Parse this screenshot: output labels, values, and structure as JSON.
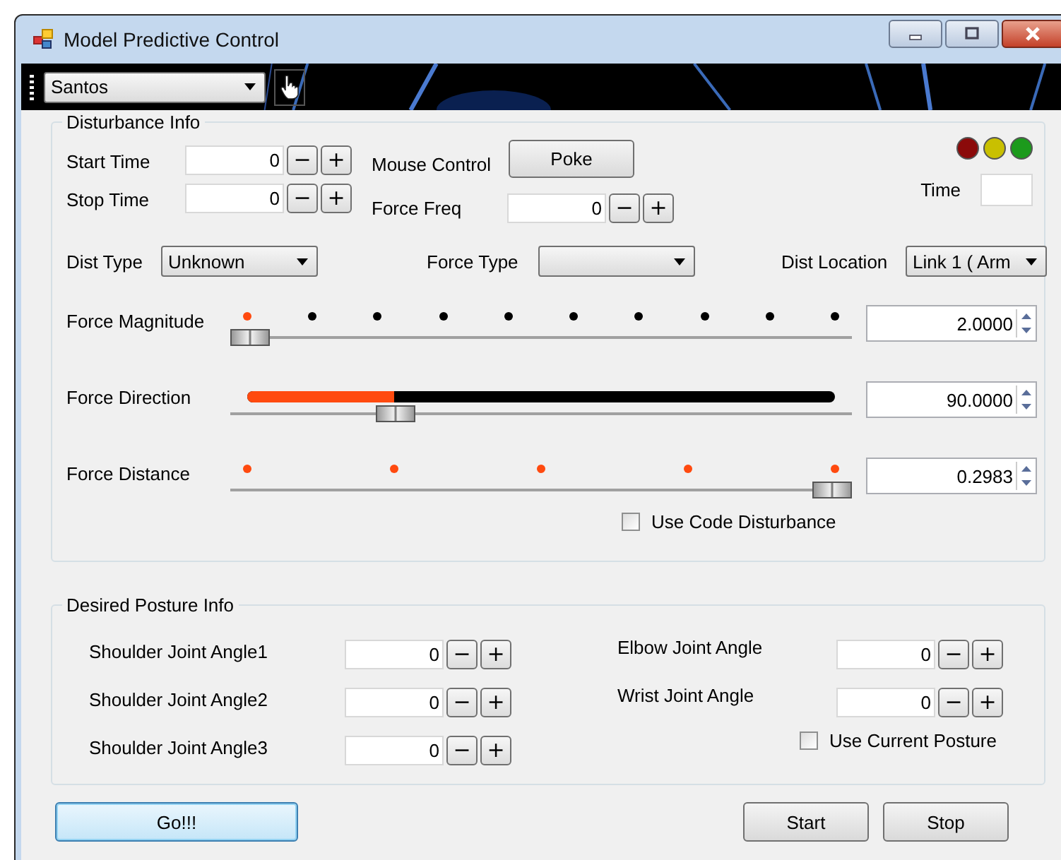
{
  "window": {
    "title": "Model Predictive Control"
  },
  "toolbar": {
    "profile": "Santos"
  },
  "disturbance": {
    "title": "Disturbance Info",
    "spinners": [
      {
        "label": "Start Time",
        "value": "0",
        "dec": "−",
        "inc": "+"
      },
      {
        "label": "Stop Time",
        "value": "0",
        "dec": "−",
        "inc": "+"
      },
      {
        "label": "Force Freq",
        "value": "0",
        "dec": "−",
        "inc": "+"
      }
    ],
    "mouse_control": {
      "label": "Mouse Control",
      "button": "Poke"
    },
    "status_lights": [
      {
        "color": "#8b0a0a"
      },
      {
        "color": "#c9c000"
      },
      {
        "color": "#1c9a1c"
      }
    ],
    "time": {
      "label": "Time"
    },
    "dropdowns": [
      {
        "label": "Dist Type",
        "value": "Unknown"
      },
      {
        "label": "Force Type"
      },
      {
        "label": "Dist Location",
        "value": "Link 1 ( Arm"
      }
    ],
    "sliders": [
      {
        "kind": "fine_ticks",
        "label": "Force Magnitude",
        "value": "2.0000",
        "level": 0.0
      },
      {
        "kind": "bar",
        "label": "Force Direction",
        "value": "90.0000",
        "level": 0.25
      },
      {
        "kind": "coarse_ticks",
        "label": "Force Distance",
        "value": "0.2983",
        "level": 1.0
      }
    ],
    "use_code_disturbance": {
      "label": "Use Code Disturbance",
      "checked": false
    }
  },
  "posture": {
    "title": "Desired Posture Info",
    "left_joints": [
      {
        "label": "Shoulder Joint Angle1",
        "value": "0",
        "dec": "−",
        "inc": "+"
      },
      {
        "label": "Shoulder Joint Angle2",
        "value": "0",
        "dec": "−",
        "inc": "+"
      },
      {
        "label": "Shoulder Joint Angle3",
        "value": "0",
        "dec": "−",
        "inc": "+"
      }
    ],
    "right_joints": [
      {
        "label": "Elbow Joint Angle",
        "value": "0",
        "dec": "−",
        "inc": "+"
      },
      {
        "label": "Wrist Joint Angle",
        "value": "0",
        "dec": "−",
        "inc": "+"
      }
    ],
    "use_current_posture": {
      "label": "Use Current Posture",
      "checked": false
    }
  },
  "buttons": [
    {
      "label": "Go!!!",
      "default": true
    },
    {
      "label": "Start",
      "default": false
    },
    {
      "label": "Stop",
      "default": false
    }
  ]
}
